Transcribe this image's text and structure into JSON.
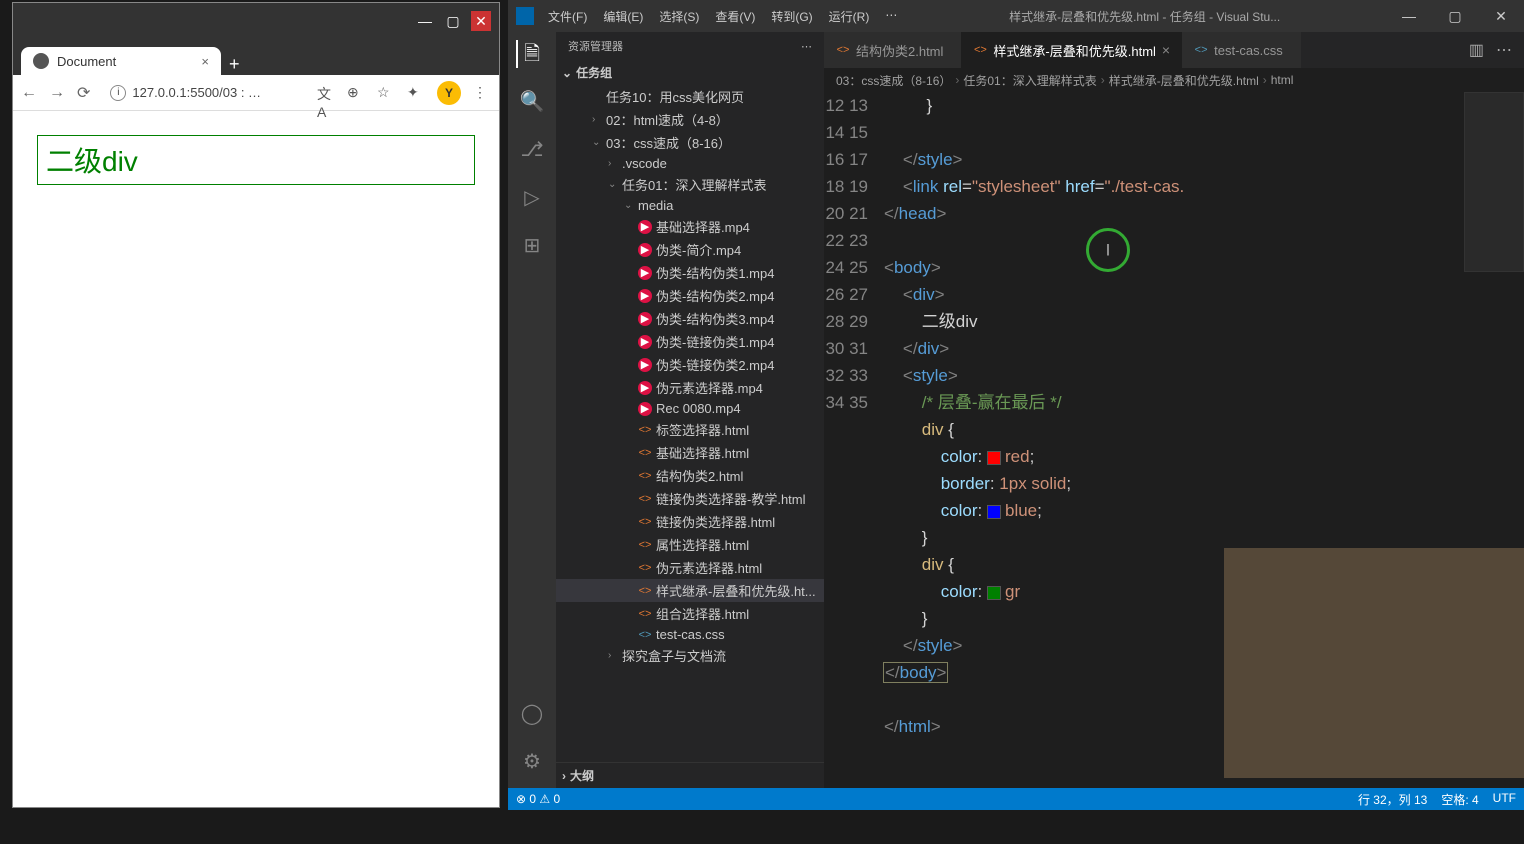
{
  "browser": {
    "tab_title": "Document",
    "url": "127.0.0.1:5500/03 : …",
    "avatar_letter": "Y",
    "page_content": "二级div"
  },
  "vscode": {
    "menus": [
      "文件(F)",
      "编辑(E)",
      "选择(S)",
      "查看(V)",
      "转到(G)",
      "运行(R)",
      "⋯"
    ],
    "title": "样式继承-层叠和优先级.html - 任务组 - Visual Stu...",
    "sidebar_title": "资源管理器",
    "project_name": "任务组",
    "tree": [
      {
        "lvl": "l2",
        "chev": "",
        "ico": "",
        "label": "任务10：用css美化网页"
      },
      {
        "lvl": "l2",
        "chev": "›",
        "ico": "",
        "label": "02：html速成（4-8）"
      },
      {
        "lvl": "l2",
        "chev": "⌄",
        "ico": "",
        "label": "03：css速成（8-16）"
      },
      {
        "lvl": "l3",
        "chev": "›",
        "ico": "",
        "label": ".vscode"
      },
      {
        "lvl": "l3",
        "chev": "⌄",
        "ico": "",
        "label": "任务01：深入理解样式表"
      },
      {
        "lvl": "l4",
        "chev": "⌄",
        "ico": "",
        "label": "media"
      },
      {
        "lvl": "l4",
        "chev": "",
        "ico": "vid",
        "label": "基础选择器.mp4"
      },
      {
        "lvl": "l4",
        "chev": "",
        "ico": "vid",
        "label": "伪类-简介.mp4"
      },
      {
        "lvl": "l4",
        "chev": "",
        "ico": "vid",
        "label": "伪类-结构伪类1.mp4"
      },
      {
        "lvl": "l4",
        "chev": "",
        "ico": "vid",
        "label": "伪类-结构伪类2.mp4"
      },
      {
        "lvl": "l4",
        "chev": "",
        "ico": "vid",
        "label": "伪类-结构伪类3.mp4"
      },
      {
        "lvl": "l4",
        "chev": "",
        "ico": "vid",
        "label": "伪类-链接伪类1.mp4"
      },
      {
        "lvl": "l4",
        "chev": "",
        "ico": "vid",
        "label": "伪类-链接伪类2.mp4"
      },
      {
        "lvl": "l4",
        "chev": "",
        "ico": "vid",
        "label": "伪元素选择器.mp4"
      },
      {
        "lvl": "l4",
        "chev": "",
        "ico": "vid",
        "label": "Rec 0080.mp4"
      },
      {
        "lvl": "l4",
        "chev": "",
        "ico": "html",
        "label": "标签选择器.html"
      },
      {
        "lvl": "l4",
        "chev": "",
        "ico": "html",
        "label": "基础选择器.html"
      },
      {
        "lvl": "l4",
        "chev": "",
        "ico": "html",
        "label": "结构伪类2.html"
      },
      {
        "lvl": "l4",
        "chev": "",
        "ico": "html",
        "label": "链接伪类选择器-教学.html"
      },
      {
        "lvl": "l4",
        "chev": "",
        "ico": "html",
        "label": "链接伪类选择器.html"
      },
      {
        "lvl": "l4",
        "chev": "",
        "ico": "html",
        "label": "属性选择器.html"
      },
      {
        "lvl": "l4",
        "chev": "",
        "ico": "html",
        "label": "伪元素选择器.html"
      },
      {
        "lvl": "l4",
        "chev": "",
        "ico": "html",
        "label": "样式继承-层叠和优先级.ht...",
        "sel": true
      },
      {
        "lvl": "l4",
        "chev": "",
        "ico": "html",
        "label": "组合选择器.html"
      },
      {
        "lvl": "l4",
        "chev": "",
        "ico": "css",
        "label": "test-cas.css"
      },
      {
        "lvl": "l3",
        "chev": "›",
        "ico": "",
        "label": "探究盒子与文档流"
      }
    ],
    "outline": "大纲",
    "tabs": [
      {
        "ico": "html",
        "label": "结构伪类2.html",
        "active": false,
        "close": ""
      },
      {
        "ico": "html",
        "label": "样式继承-层叠和优先级.html",
        "active": true,
        "close": "×"
      },
      {
        "ico": "css",
        "label": "test-cas.css",
        "active": false,
        "close": ""
      }
    ],
    "breadcrumb": [
      "03：css速成（8-16）",
      "任务01：深入理解样式表",
      "样式继承-层叠和优先级.html",
      "html"
    ],
    "code_start": 12,
    "code": [
      {
        "html": "         <span class='tk-text'>}</span>"
      },
      {
        "html": ""
      },
      {
        "html": "    <span class='tk-punct'>&lt;/</span><span class='tk-tag'>style</span><span class='tk-punct'>&gt;</span>"
      },
      {
        "html": "    <span class='tk-punct'>&lt;</span><span class='tk-tag'>link</span> <span class='tk-attr'>rel</span>=<span class='tk-str'>\"stylesheet\"</span> <span class='tk-attr'>href</span>=<span class='tk-str'>\"./test-cas.</span>"
      },
      {
        "html": "<span class='tk-punct'>&lt;/</span><span class='tk-tag'>head</span><span class='tk-punct'>&gt;</span>"
      },
      {
        "html": ""
      },
      {
        "html": "<span class='tk-punct'>&lt;</span><span class='tk-tag'>body</span><span class='tk-punct'>&gt;</span>"
      },
      {
        "html": "    <span class='tk-punct'>&lt;</span><span class='tk-tag'>div</span><span class='tk-punct'>&gt;</span>"
      },
      {
        "html": "        <span class='tk-text'>二级div</span>"
      },
      {
        "html": "    <span class='tk-punct'>&lt;/</span><span class='tk-tag'>div</span><span class='tk-punct'>&gt;</span>"
      },
      {
        "html": "    <span class='tk-punct'>&lt;</span><span class='tk-tag'>style</span><span class='tk-punct'>&gt;</span>"
      },
      {
        "html": "        <span class='tk-comment'>/* 层叠-赢在最后 */</span>"
      },
      {
        "html": "        <span class='tk-sel'>div</span> <span class='tk-text'>{</span>"
      },
      {
        "html": "            <span class='tk-prop'>color</span>: <span class='swatch' style='background:red'></span><span class='tk-val'>red</span>;"
      },
      {
        "html": "            <span class='tk-prop'>border</span>: <span class='tk-val'>1px solid</span>;"
      },
      {
        "html": "            <span class='tk-prop'>color</span>: <span class='swatch' style='background:blue'></span><span class='tk-val'>blue</span>;"
      },
      {
        "html": "        <span class='tk-text'>}</span>"
      },
      {
        "html": "        <span class='tk-sel'>div</span> <span class='tk-text'>{</span>"
      },
      {
        "html": "            <span class='tk-prop'>color</span>: <span class='swatch' style='background:green'></span><span class='tk-val'>gr</span>"
      },
      {
        "html": "        <span class='tk-text'>}</span>"
      },
      {
        "html": "    <span class='tk-punct'>&lt;/</span><span class='tk-tag'>style</span><span class='tk-punct'>&gt;</span>"
      },
      {
        "html": "<span class='hl-box'><span class='tk-punct'>&lt;/</span><span class='tk-tag'>body</span><span class='tk-punct'>&gt;</span></span>"
      },
      {
        "html": ""
      },
      {
        "html": "<span class='tk-punct'>&lt;/</span><span class='tk-tag'>html</span><span class='tk-punct'>&gt;</span>"
      }
    ],
    "status": {
      "errors": "⊗ 0 ⚠ 0",
      "pos": "行 32，列 13",
      "spaces": "空格: 4",
      "enc": "UTF"
    }
  }
}
